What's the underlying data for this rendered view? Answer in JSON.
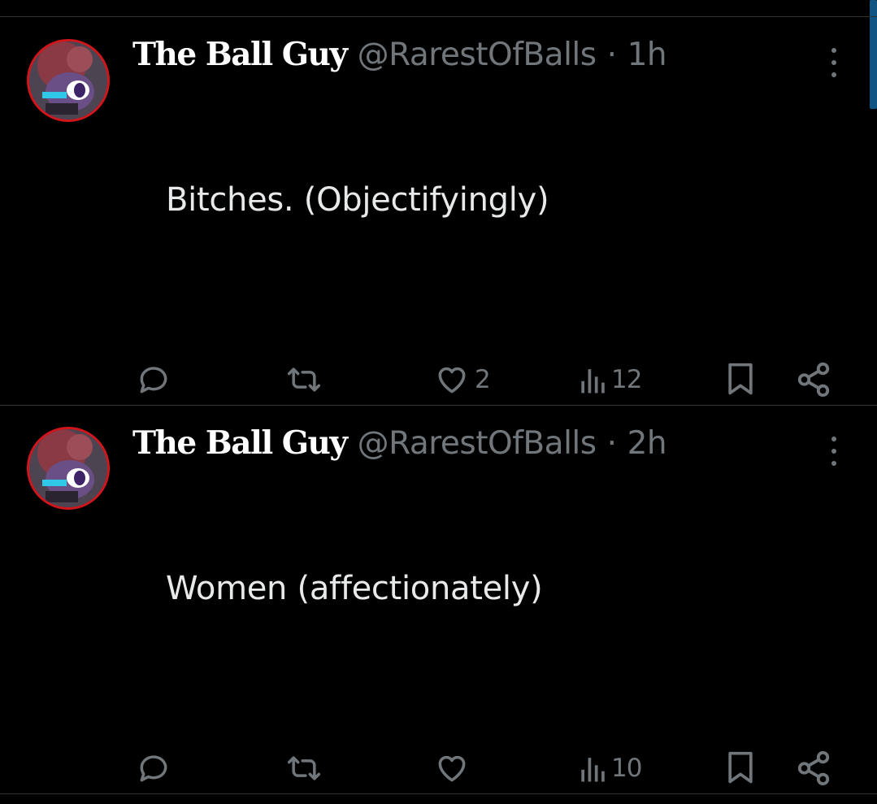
{
  "tweets": [
    {
      "display_name": "The Ball Guy",
      "handle": "@RarestOfBalls",
      "separator": "·",
      "time": "1h",
      "text": "Bitches. (Objectifyingly)",
      "actions": {
        "replies": "",
        "retweets": "",
        "likes": "2",
        "views": "12"
      }
    },
    {
      "display_name": "The Ball Guy",
      "handle": "@RarestOfBalls",
      "separator": "·",
      "time": "2h",
      "text": "Women (affectionately)",
      "actions": {
        "replies": "",
        "retweets": "",
        "likes": "",
        "views": "10"
      }
    }
  ],
  "icons": [
    "reply-icon",
    "retweet-icon",
    "like-icon",
    "views-icon",
    "bookmark-icon",
    "share-icon",
    "more-icon"
  ],
  "colors": {
    "background": "#000000",
    "text": "#e7e9ea",
    "secondary": "#71767b",
    "divider": "#2f3336",
    "avatar_border": "#d0161b"
  }
}
